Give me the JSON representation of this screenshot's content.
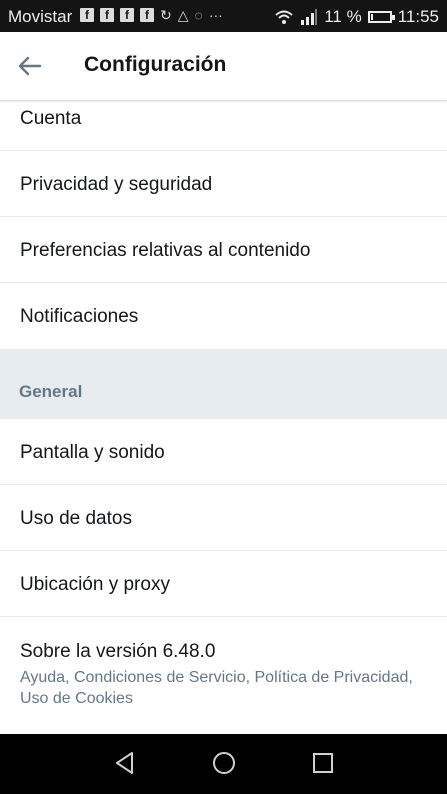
{
  "status_bar": {
    "carrier": "Movistar",
    "battery_text": "11 %",
    "time": "11:55",
    "battery_level": 0.11,
    "icons": [
      "facebook-icon",
      "facebook-icon",
      "facebook-icon",
      "facebook-icon",
      "sync-icon",
      "recycle-icon",
      "chat-icon",
      "more-icon",
      "wifi-icon",
      "signal-icon",
      "battery-icon"
    ]
  },
  "header": {
    "title": "Configuración"
  },
  "settings": {
    "account": "Cuenta",
    "privacy": "Privacidad y seguridad",
    "content_prefs": "Preferencias relativas al contenido",
    "notifications": "Notificaciones",
    "general_header": "General",
    "display": "Pantalla y sonido",
    "data_usage": "Uso de datos",
    "location": "Ubicación y proxy",
    "about_title": "Sobre la versión 6.48.0",
    "about_sub": "Ayuda, Condiciones de Servicio, Política de Privacidad, Uso de Cookies"
  }
}
